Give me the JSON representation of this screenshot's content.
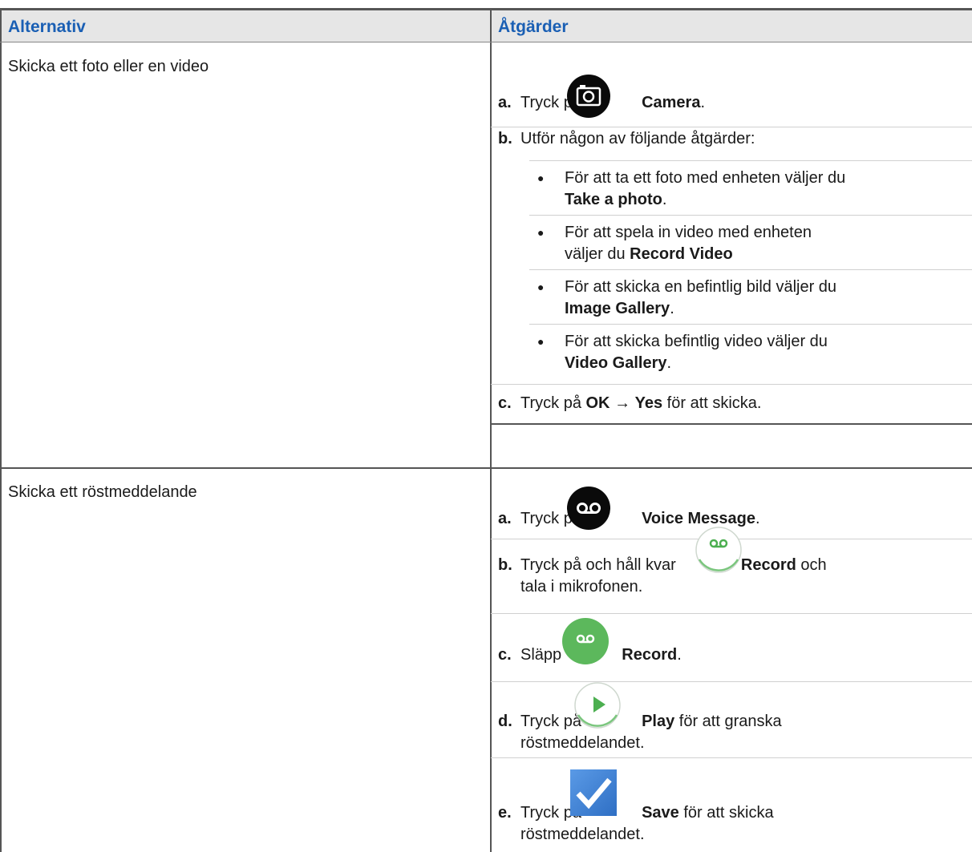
{
  "header": {
    "col1": "Alternativ",
    "col2": "Åtgärder"
  },
  "rows": [
    {
      "option": "Skicka ett foto eller en video",
      "steps": {
        "a": {
          "label": "a.",
          "pre": "Tryck på",
          "bold": "Camera",
          "post": "."
        },
        "b": {
          "label": "b.",
          "text": "Utför någon av följande åtgärder:"
        },
        "bullets": [
          {
            "line1": "För att ta ett foto med enheten väljer du",
            "bold": "Take a photo",
            "post": "."
          },
          {
            "line1": "För att spela in video med enheten",
            "line2_pre": "väljer du",
            "bold": "Record Video",
            "post": ""
          },
          {
            "line1": "För att skicka en befintlig bild väljer du",
            "bold": "Image Gallery",
            "post": "."
          },
          {
            "line1": "För att skicka befintlig video väljer du",
            "bold": "Video Gallery",
            "post": "."
          }
        ],
        "c": {
          "label": "c.",
          "pre": "Tryck på",
          "bold1": "OK",
          "arrow": "→",
          "bold2": "Yes",
          "post": "för att skicka."
        }
      }
    },
    {
      "option": "Skicka ett röstmeddelande",
      "steps": {
        "a": {
          "label": "a.",
          "pre": "Tryck på",
          "bold": "Voice Message",
          "post": "."
        },
        "b": {
          "label": "b.",
          "pre": "Tryck på och håll kvar",
          "bold": "Record",
          "post": "och",
          "line2": "tala i mikrofonen."
        },
        "c": {
          "label": "c.",
          "pre": "Släpp",
          "bold": "Record",
          "post": "."
        },
        "d": {
          "label": "d.",
          "pre": "Tryck på",
          "bold": "Play",
          "post": "för att granska",
          "line2": "röstmeddelandet."
        },
        "e": {
          "label": "e.",
          "pre": "Tryck på",
          "bold": "Save",
          "post": "för att skicka",
          "line2": "röstmeddelandet."
        }
      }
    }
  ],
  "icons": {
    "camera": "camera-icon",
    "voicemail": "voicemail-icon",
    "record_outline": "record-outline-icon",
    "record_green": "record-green-icon",
    "play": "play-icon",
    "save": "checkmark-icon"
  },
  "colors": {
    "header_text": "#1a5fb4",
    "header_bg": "#e6e6e6",
    "green": "#4caf50",
    "check_blue": "#3d7fd6"
  }
}
